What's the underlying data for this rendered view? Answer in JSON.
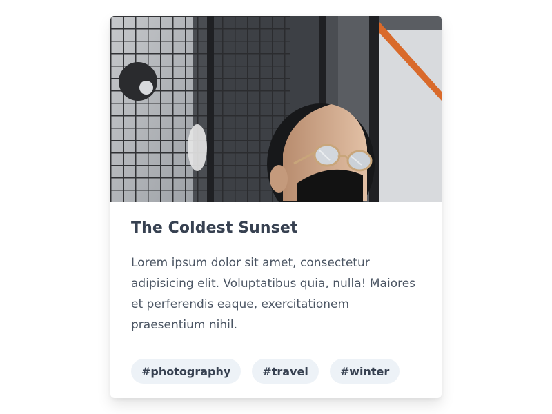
{
  "card": {
    "title": "The Coldest Sunset",
    "description": "Lorem ipsum dolor sit amet, consectetur adipisicing elit. Voluptatibus quia, nulla! Maiores et perferendis eaque, exercitationem praesentium nihil.",
    "tags": [
      "#photography",
      "#travel",
      "#winter"
    ],
    "image": {
      "subject": "person-with-sunglasses-and-mask"
    }
  },
  "colors": {
    "page_background": "#ffffff",
    "card_background": "#ffffff",
    "title_text": "#374151",
    "body_text": "#4b5563",
    "tag_background": "#edf2f7",
    "accent_orange": "#d96a2b"
  }
}
